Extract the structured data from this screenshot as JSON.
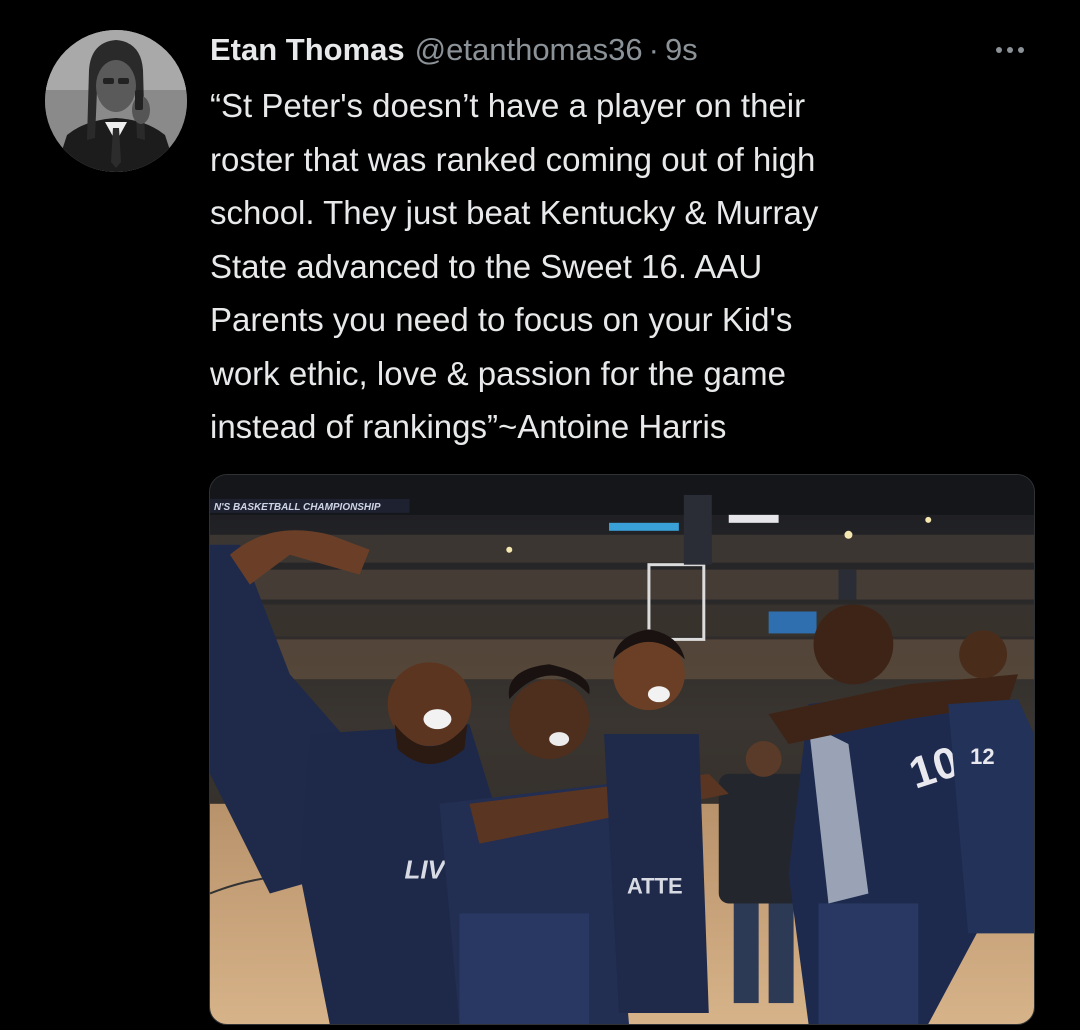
{
  "tweet": {
    "display_name": "Etan Thomas",
    "handle": "@etanthomas36",
    "separator": "·",
    "time": "9s",
    "text_lines": [
      "“St Peter's doesn’t have a player on their",
      "roster that was ranked coming out of high",
      "school.  They just beat Kentucky & Murray",
      "State advanced to the Sweet 16. AAU",
      "Parents you need to focus on your Kid's",
      "work ethic, love & passion for the game",
      "instead of rankings”~Antoine Harris"
    ],
    "more_icon": "ellipsis-horizontal-icon"
  },
  "photo": {
    "banner_text": "N'S BASKETBALL CHAMPIONSHIP",
    "jersey_number_left": "10",
    "jersey_number_right": "12",
    "shirt_text_1": "LIV",
    "shirt_text_2": "ATTE"
  },
  "colors": {
    "background": "#000000",
    "text_primary": "#e7e9ea",
    "text_secondary": "#8b9298",
    "jersey_navy": "#1f2a4a",
    "court_wood": "#c9a57a"
  }
}
